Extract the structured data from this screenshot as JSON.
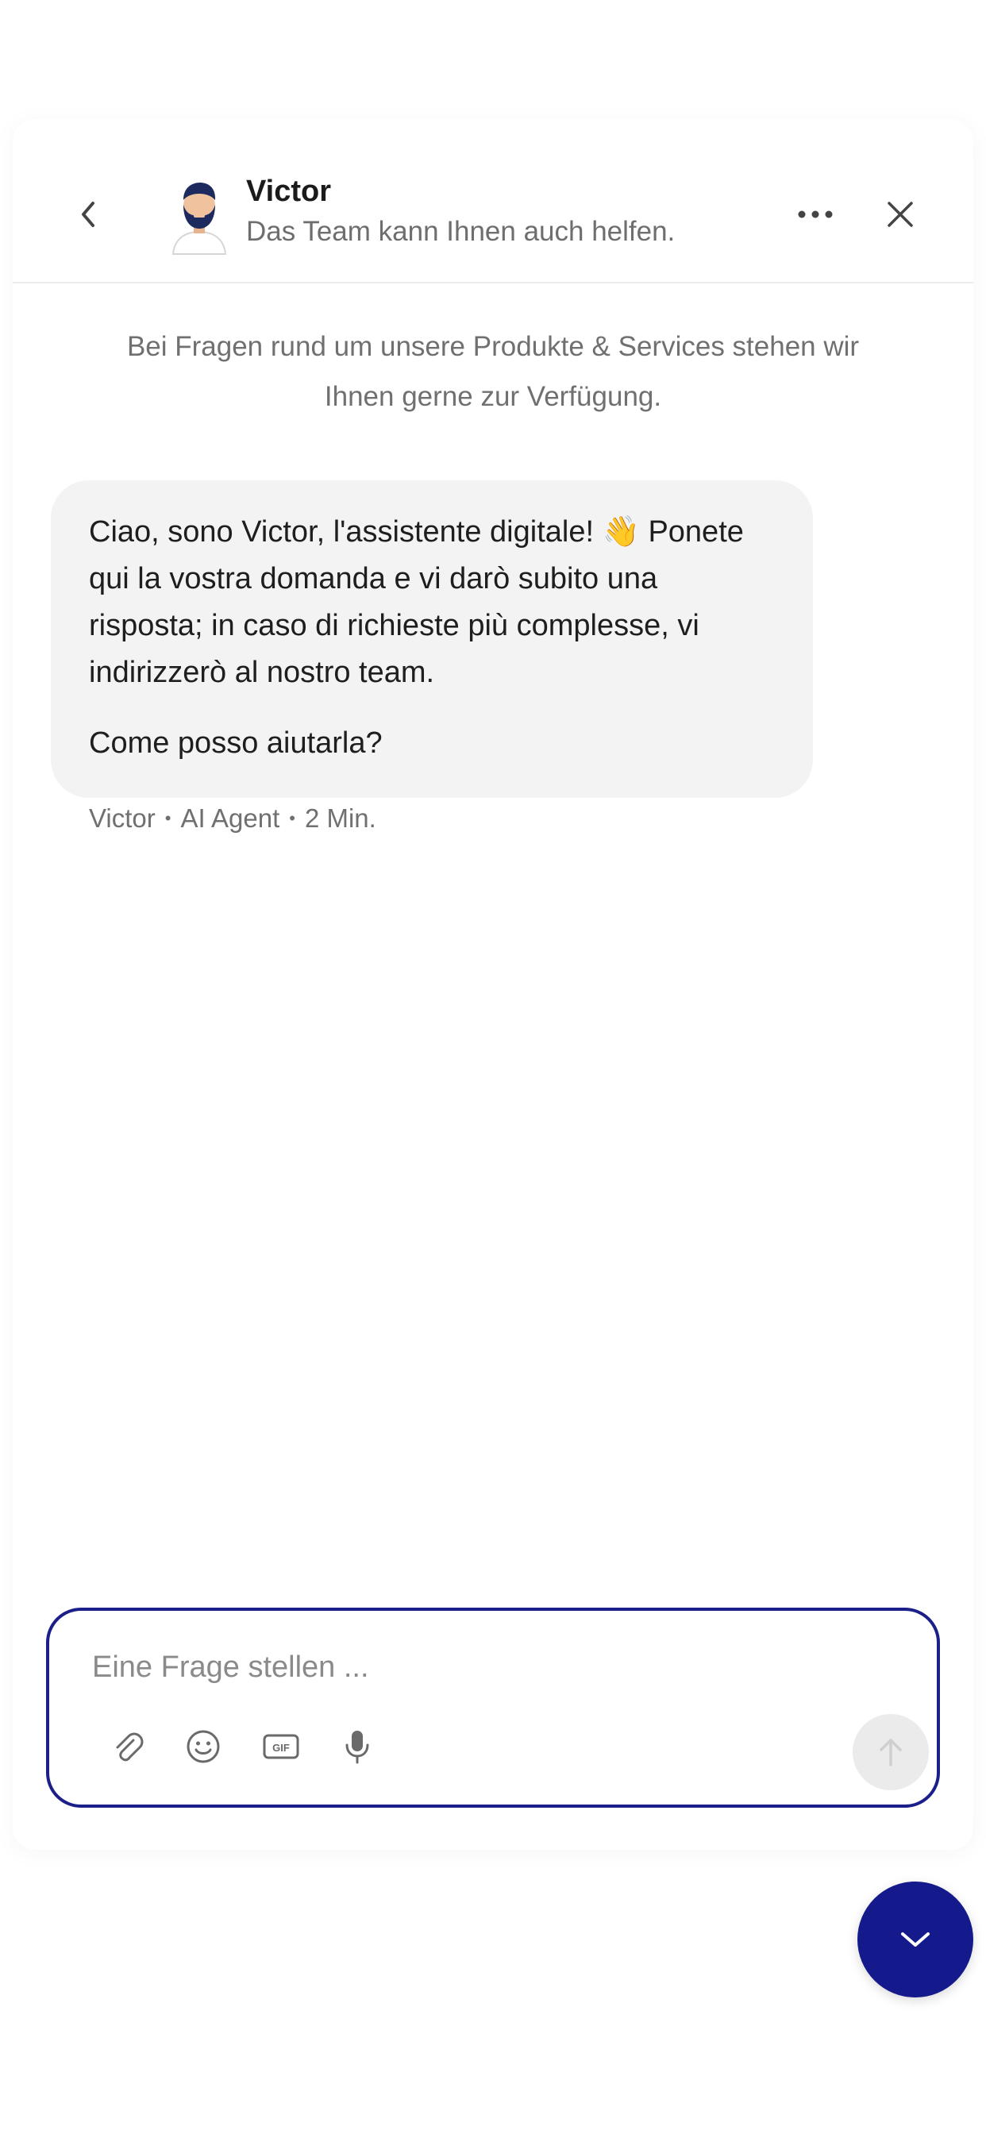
{
  "header": {
    "agent_name": "Victor",
    "subtitle": "Das Team kann Ihnen auch helfen.",
    "icons": {
      "back": "chevron-left-icon",
      "more": "more-horizontal-icon",
      "close": "close-icon",
      "avatar": "avatar-bearded-man"
    }
  },
  "intro": {
    "text": "Bei Fragen rund um unsere Produkte & Services stehen wir Ihnen gerne zur Verfügung."
  },
  "message": {
    "paragraph_1": "Ciao, sono Victor, l'assistente digitale! 👋 Ponete qui la vostra domanda e vi darò subito una risposta; in caso di richieste più complesse, vi indirizzerò al nostro team.",
    "paragraph_2": "Come posso aiutarla?",
    "meta": {
      "sender": "Victor",
      "role": "AI Agent",
      "time": "2 Min."
    }
  },
  "composer": {
    "placeholder": "Eine Frage stellen ...",
    "value": "",
    "tools": [
      "paperclip-icon",
      "smiley-icon",
      "gif-icon",
      "microphone-icon"
    ],
    "send_icon": "arrow-up-icon"
  },
  "fab": {
    "icon": "chevron-down-icon"
  },
  "colors": {
    "accent": "#1a1f8a",
    "fab": "#141a8c",
    "bubble": "#f3f3f3",
    "muted_text": "#707070"
  }
}
